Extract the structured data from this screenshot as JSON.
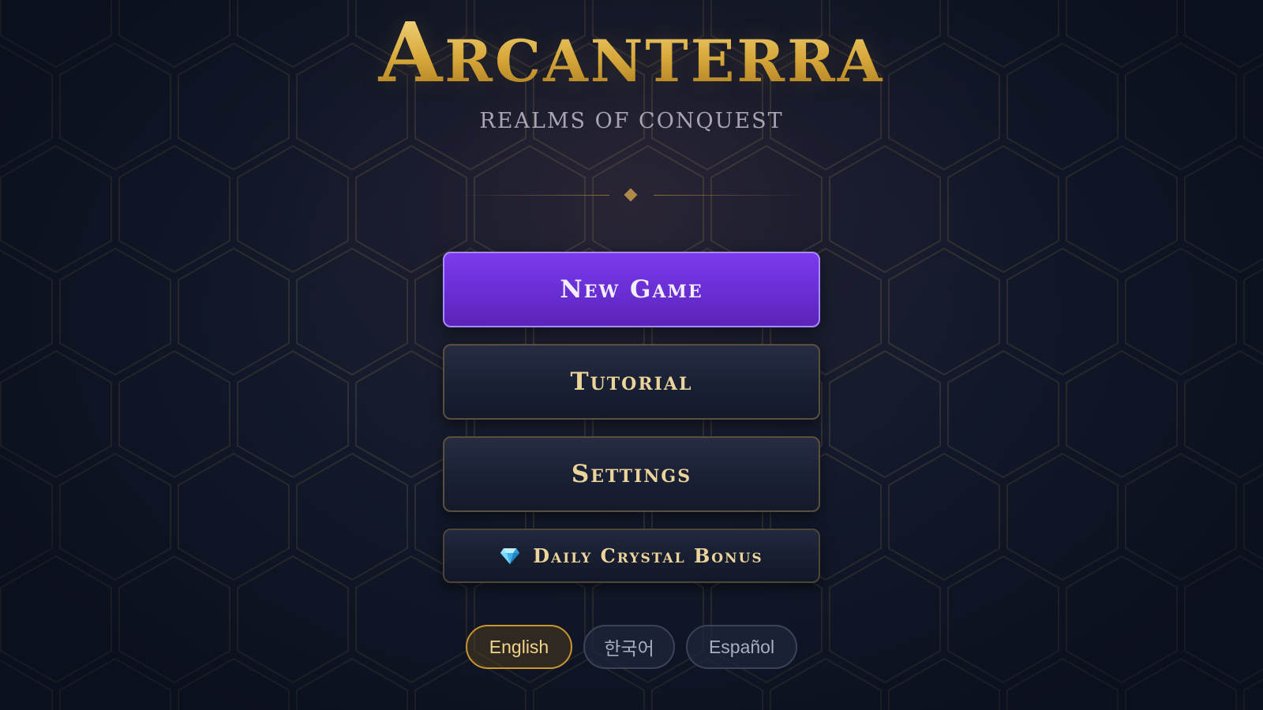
{
  "game": {
    "title": "Arcanterra",
    "subtitle": "REALMS OF CONQUEST"
  },
  "menu": {
    "new_game": "New Game",
    "tutorial": "Tutorial",
    "settings": "Settings",
    "daily_bonus": {
      "icon": "gem-icon",
      "label": "Daily Crystal Bonus"
    }
  },
  "languages": {
    "selected": "English",
    "options": [
      "English",
      "한국어",
      "Español"
    ]
  },
  "colors": {
    "title_gold": "#d9aa3c",
    "primary_purple": "#7c3aed",
    "button_text_gold": "#ecd49a",
    "background_navy": "#131a2c"
  }
}
